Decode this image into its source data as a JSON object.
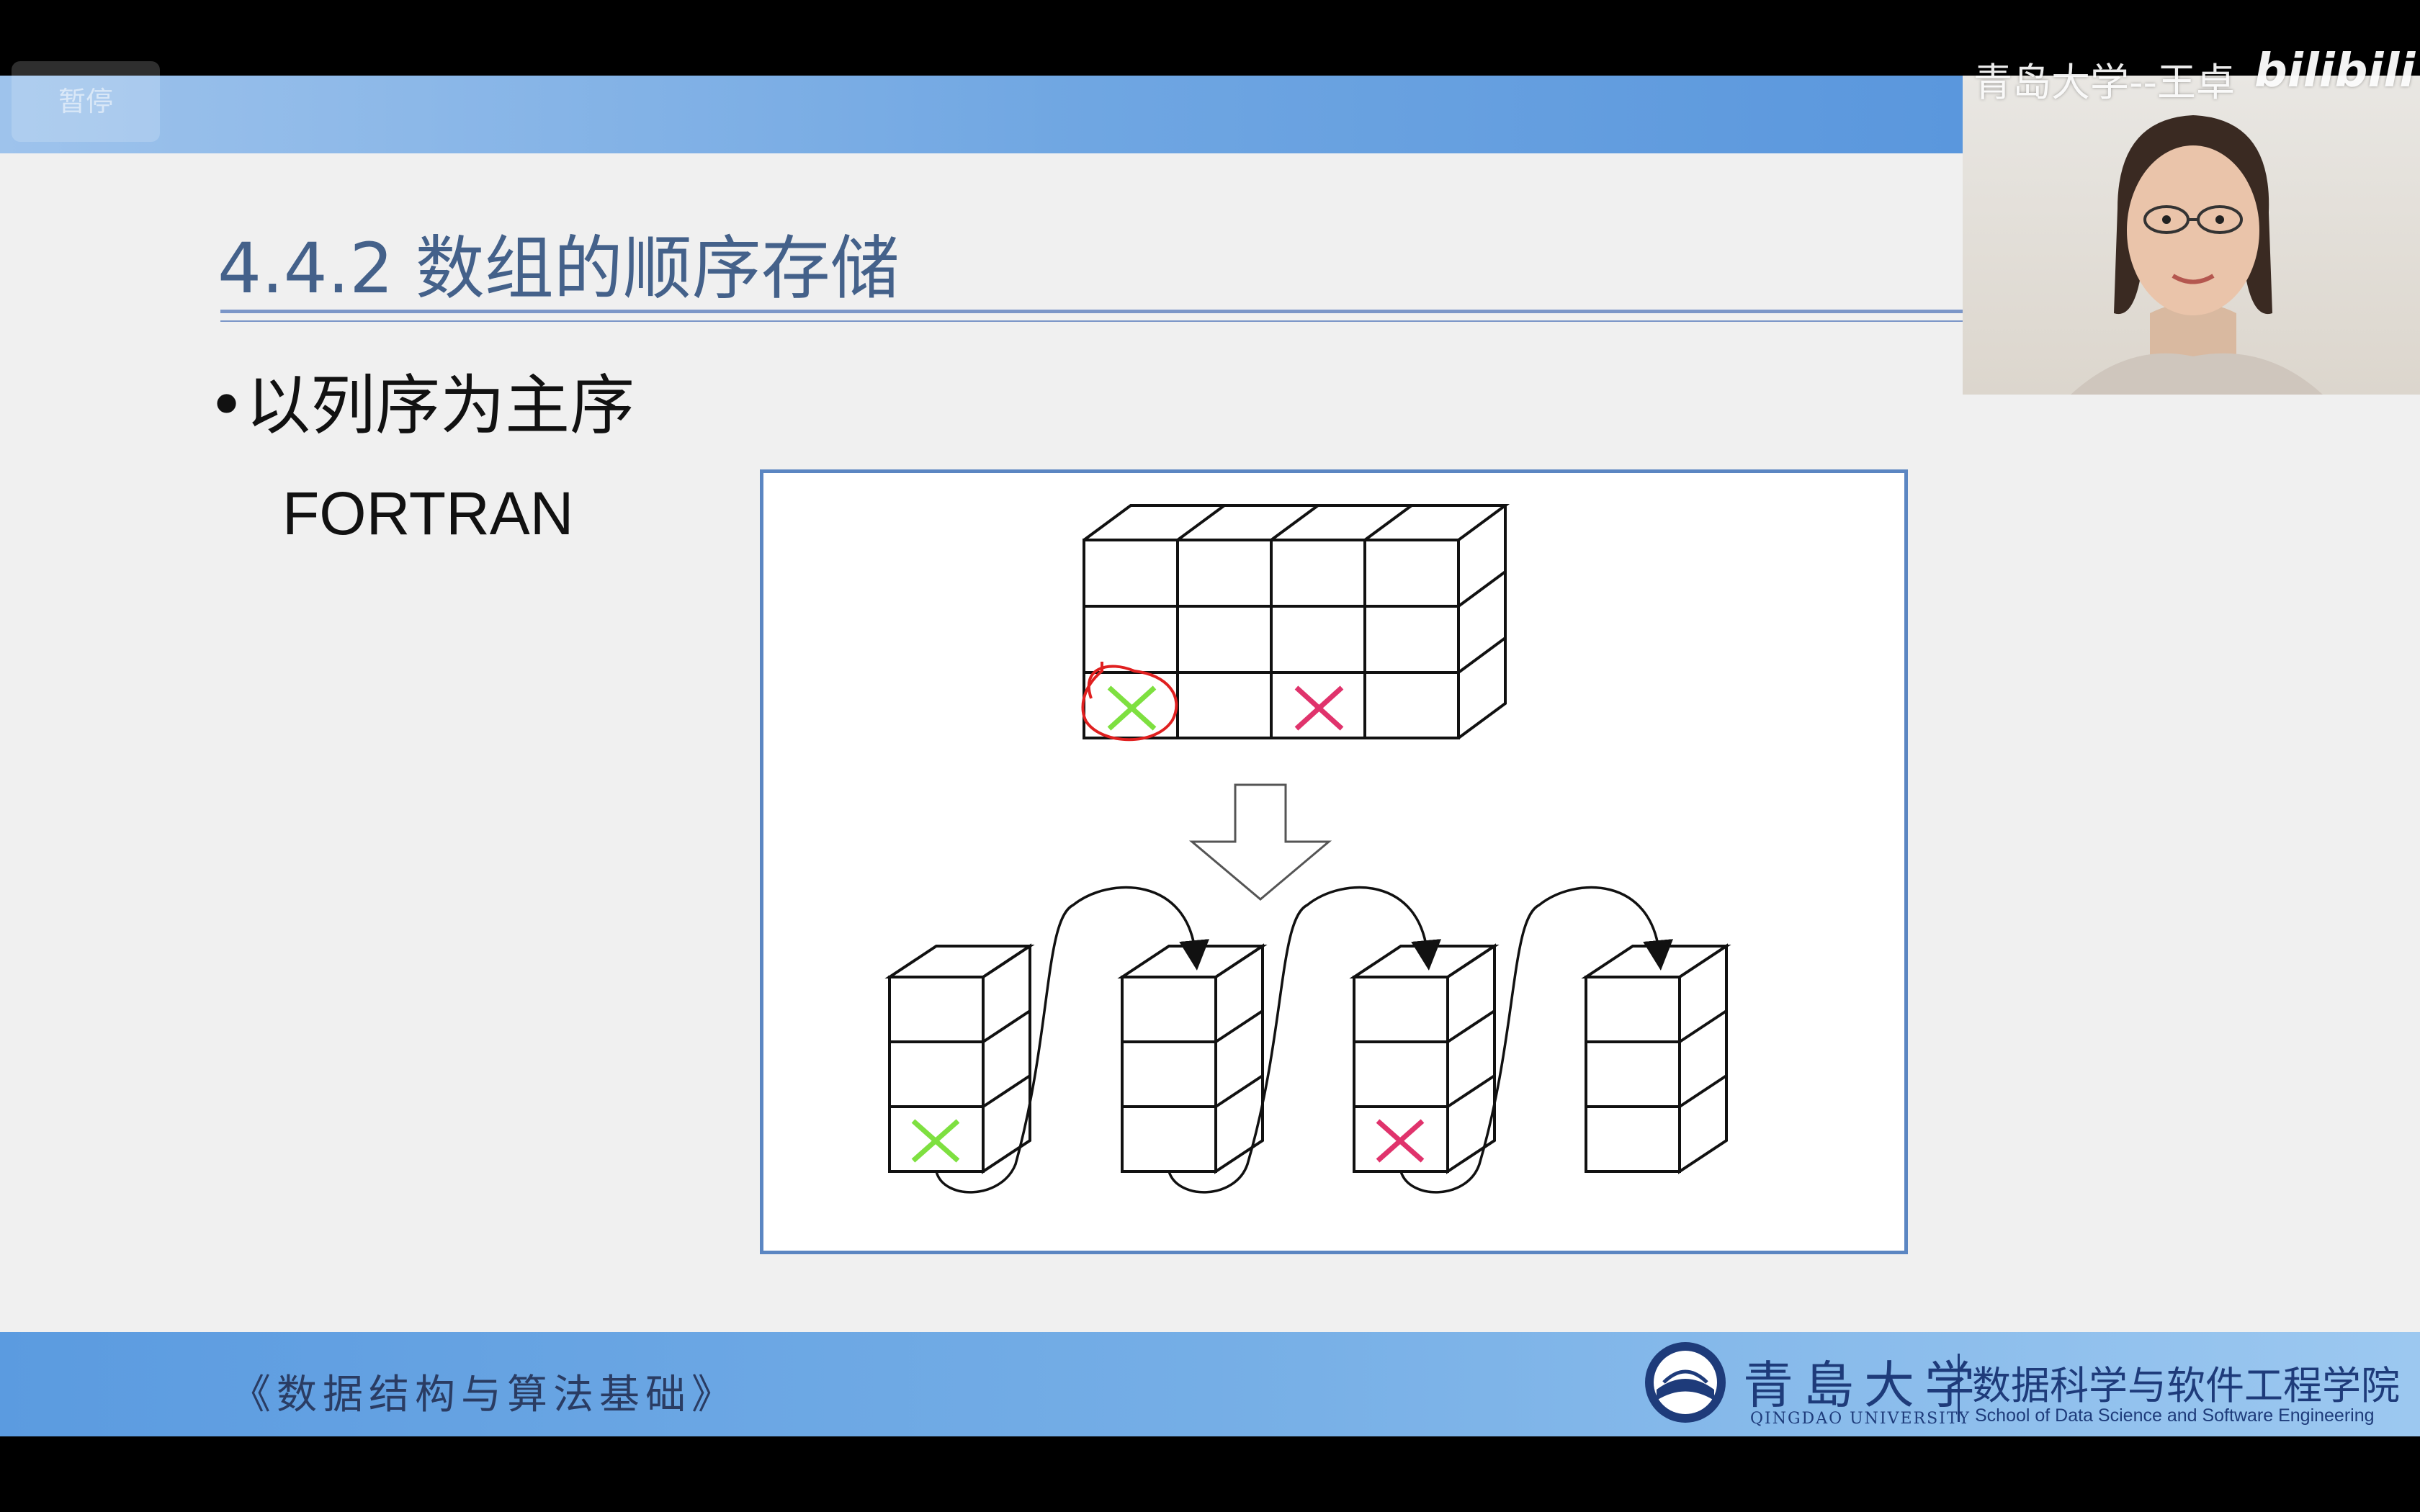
{
  "player": {
    "pause_label": "暂停"
  },
  "slide": {
    "title": "4.4.2 数组的顺序存储",
    "bullet": "•以列序为主序",
    "subtitle": "FORTRAN"
  },
  "footer": {
    "course": "《数据结构与算法基础》",
    "university_cn": "青島大学",
    "university_en": "QINGDAO UNIVERSITY",
    "school_cn": "数据科学与软件工程学院",
    "school_en": "School of Data Science and Software Engineering"
  },
  "overlay": {
    "watermark": "青岛大学--王卓",
    "site_logo": "bilibili"
  },
  "colors": {
    "title": "#44618a",
    "rule": "#7b96c8",
    "green_mark": "#7ee040",
    "pink_mark": "#e0336c",
    "annotation": "#e02020",
    "footer_text": "#1e3b7a"
  }
}
